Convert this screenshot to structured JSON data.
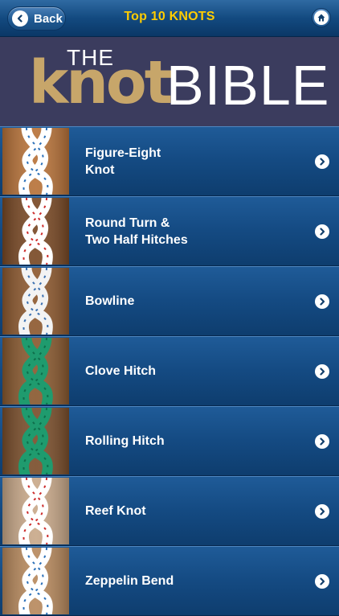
{
  "nav": {
    "back_label": "Back",
    "title": "Top 10 KNOTS"
  },
  "banner": {
    "the": "THE",
    "knot": "knot",
    "bible": "BIBLE"
  },
  "knots": [
    {
      "label": "Figure-Eight\nKnot",
      "rope": "#ffffff",
      "accent": "#2a6fb8",
      "wood": "#b8733a"
    },
    {
      "label": "Round Turn &\nTwo Half Hitches",
      "rope": "#ffffff",
      "accent": "#cc2b2b",
      "wood": "#7a4a26"
    },
    {
      "label": "Bowline",
      "rope": "#f3f3f3",
      "accent": "#3a6fb0",
      "wood": "#8e5a30"
    },
    {
      "label": "Clove Hitch",
      "rope": "#1f9b6e",
      "accent": "#0f6e4b",
      "wood": "#8a5a30"
    },
    {
      "label": "Rolling Hitch",
      "rope": "#1f9b6e",
      "accent": "#0f6e4b",
      "wood": "#7b4f2c"
    },
    {
      "label": "Reef Knot",
      "rope": "#ffffff",
      "accent": "#cc2b2b",
      "wood": "#c9a98a"
    },
    {
      "label": "Zeppelin Bend",
      "rope": "#ffffff",
      "accent": "#2a6fb8",
      "wood": "#b88a5e"
    }
  ],
  "icons": {
    "back": "chevron-left-icon",
    "home": "home-icon",
    "row": "chevron-right-icon"
  }
}
